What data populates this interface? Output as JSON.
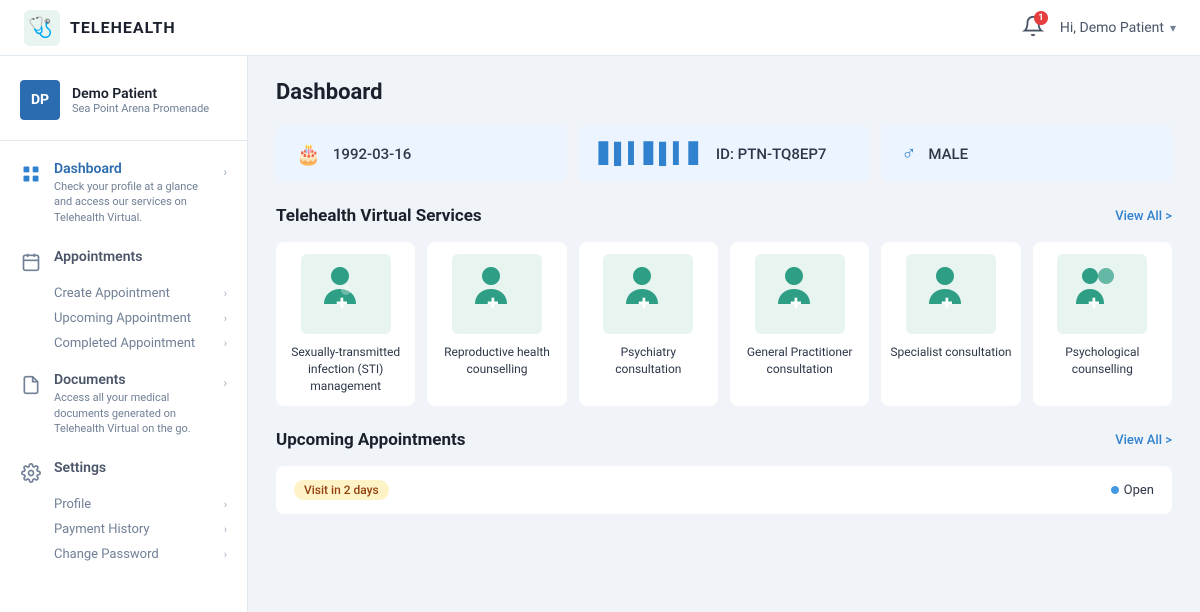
{
  "header": {
    "logo_text": "TELEHEALTH",
    "notification_count": "1",
    "user_greeting": "Hi, Demo Patient"
  },
  "sidebar": {
    "user": {
      "initials": "DP",
      "name": "Demo Patient",
      "subtitle": "Sea Point Arena Promenade"
    },
    "nav": [
      {
        "id": "dashboard",
        "title": "Dashboard",
        "desc": "Check your profile at a glance and access our services on Telehealth Virtual.",
        "active": true,
        "has_chevron": true,
        "sub_items": []
      },
      {
        "id": "appointments",
        "title": "Appointments",
        "desc": "",
        "active": false,
        "has_chevron": false,
        "sub_items": [
          "Create Appointment",
          "Upcoming Appointment",
          "Completed Appointment"
        ]
      },
      {
        "id": "documents",
        "title": "Documents",
        "desc": "Access all your medical documents generated on Telehealth Virtual on the go.",
        "active": false,
        "has_chevron": true,
        "sub_items": []
      },
      {
        "id": "settings",
        "title": "Settings",
        "desc": "",
        "active": false,
        "has_chevron": false,
        "sub_items": [
          "Profile",
          "Payment History",
          "Change Password"
        ]
      }
    ]
  },
  "main": {
    "page_title": "Dashboard",
    "info_cards": [
      {
        "icon": "birthday",
        "value": "1992-03-16"
      },
      {
        "icon": "barcode",
        "value": "ID: PTN-TQ8EP7"
      },
      {
        "icon": "gender",
        "value": "MALE"
      }
    ],
    "services_section": {
      "title": "Telehealth Virtual Services",
      "view_all": "View All >",
      "services": [
        {
          "label": "Sexually-transmitted infection (STI) management"
        },
        {
          "label": "Reproductive health counselling"
        },
        {
          "label": "Psychiatry consultation"
        },
        {
          "label": "General Practitioner consultation"
        },
        {
          "label": "Specialist consultation"
        },
        {
          "label": "Psychological counselling"
        }
      ]
    },
    "upcoming_section": {
      "title": "Upcoming Appointments",
      "view_all": "View All >",
      "badge": "Visit in 2 days",
      "status": "Open"
    }
  }
}
